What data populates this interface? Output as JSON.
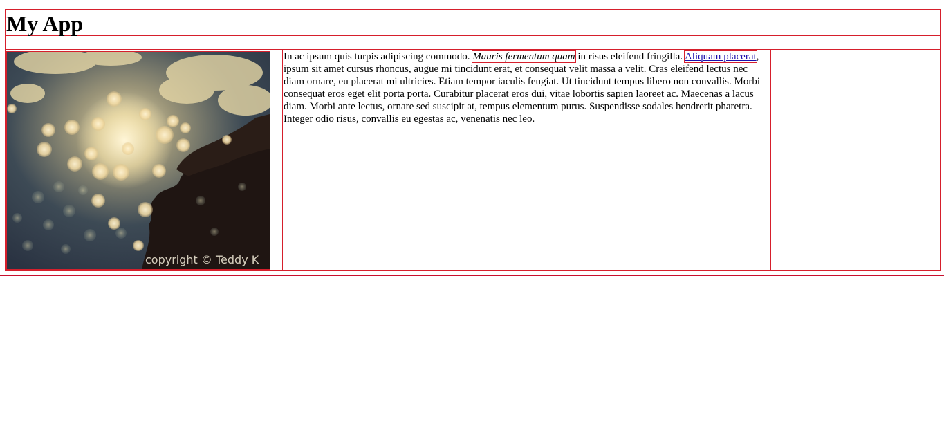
{
  "header": {
    "title": "My App"
  },
  "image": {
    "caption": "copyright © Teddy K"
  },
  "article": {
    "text_before": "In ac ipsum quis turpis adipiscing commodo. ",
    "emphasis": "Mauris fermentum quam",
    "text_middle": " in risus eleifend fringilla. ",
    "link": "Aliquam placerat",
    "text_after": ", ipsum sit amet cursus rhoncus, augue mi tincidunt erat, et consequat velit massa a velit. Cras eleifend lectus nec diam ornare, eu placerat mi ultricies. Etiam tempor iaculis feugiat. Ut tincidunt tempus libero non convallis. Morbi consequat eros eget elit porta porta. Curabitur placerat eros dui, vitae lobortis sapien laoreet ac. Maecenas a lacus diam. Morbi ante lectus, ornare sed suscipit at, tempus elementum purus. Suspendisse sodales hendrerit pharetra. Integer odio risus, convallis eu egestas ac, venenatis nec leo."
  },
  "colors": {
    "border": "#d61f2c",
    "link": "#1a0dab"
  }
}
